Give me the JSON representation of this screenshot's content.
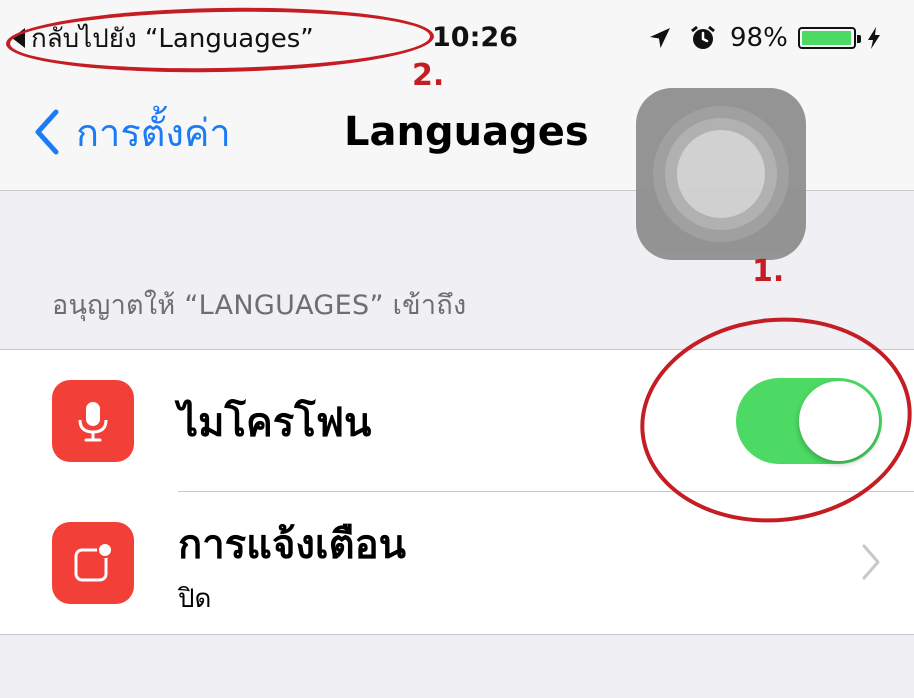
{
  "status_bar": {
    "back_app_label": "กลับไปยัง “Languages”",
    "time": "10:26",
    "battery_percent": "98%",
    "battery_level": 0.98
  },
  "nav_bar": {
    "back_label": "การตั้งค่า",
    "title": "Languages"
  },
  "section": {
    "header": "อนุญาตให้ “LANGUAGES” เข้าถึง",
    "rows": [
      {
        "label": "ไมโครโฟน",
        "toggle_on": true
      },
      {
        "label": "การแจ้งเตือน",
        "sublabel": "ปิด"
      }
    ]
  },
  "annotations": {
    "label_1": "1.",
    "label_2": "2."
  },
  "colors": {
    "ios_blue": "#1a7cf5",
    "toggle_green": "#4cd964",
    "app_icon_red": "#f23f38",
    "annotation_red": "#c41e24"
  }
}
